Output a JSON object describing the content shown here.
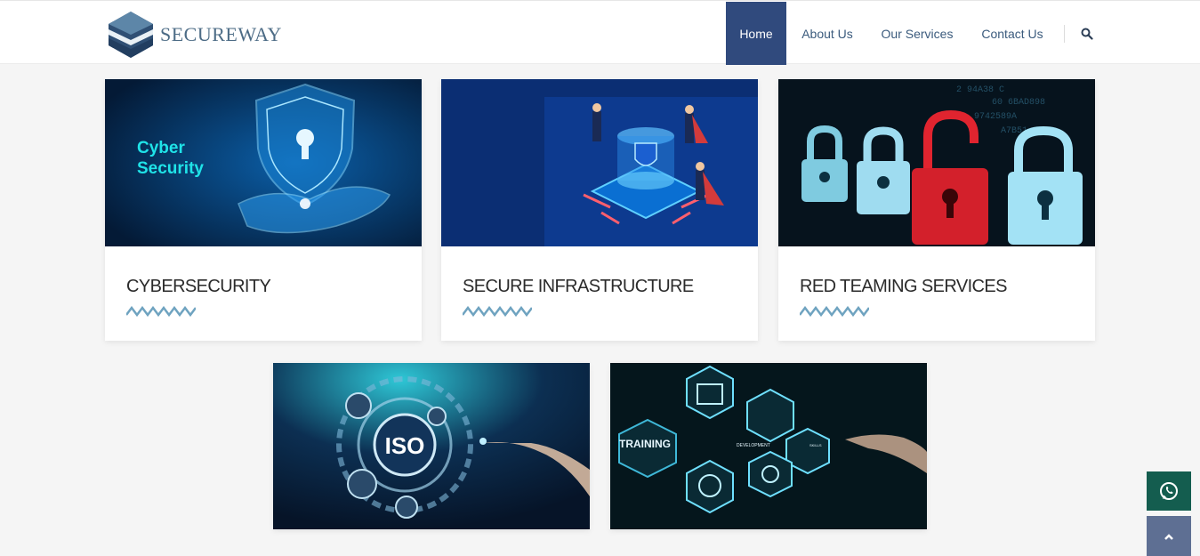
{
  "brand": {
    "name": "SECUREWAY",
    "primary_color": "#304a7d",
    "accent_color": "#4d6c86"
  },
  "nav": {
    "items": [
      {
        "label": "Home",
        "active": true
      },
      {
        "label": "About Us",
        "active": false
      },
      {
        "label": "Our Services",
        "active": false
      },
      {
        "label": "Contact Us",
        "active": false
      }
    ],
    "search_icon": "search-icon"
  },
  "services": [
    {
      "title": "CYBERSECURITY",
      "image_text": [
        "Cyber",
        "Security"
      ]
    },
    {
      "title": "SECURE INFRASTRUCTURE"
    },
    {
      "title": "RED TEAMING SERVICES"
    },
    {
      "image_text": [
        "ISO"
      ]
    },
    {
      "image_text": [
        "TRAINING",
        "DEVELOPMENT",
        "SKILLS"
      ]
    }
  ],
  "floating": {
    "whatsapp_icon": "whatsapp-icon",
    "scroll_top_icon": "chevron-up-icon",
    "whatsapp_color": "#145d4f"
  }
}
